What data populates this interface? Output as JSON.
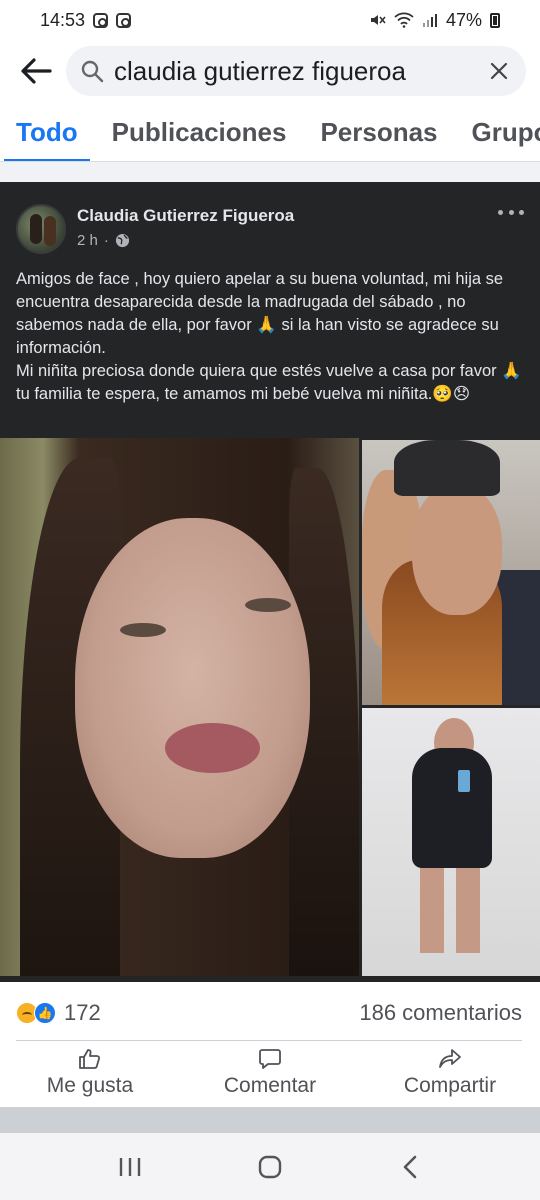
{
  "status_bar": {
    "time": "14:53",
    "battery": "47%"
  },
  "search": {
    "query": "claudia gutierrez figueroa"
  },
  "tabs": [
    {
      "label": "Todo"
    },
    {
      "label": "Publicaciones"
    },
    {
      "label": "Personas"
    },
    {
      "label": "Grupos"
    }
  ],
  "post": {
    "author": "Claudia Gutierrez Figueroa",
    "time": "2 h",
    "separator": "·",
    "body_p1": "Amigos de face , hoy quiero apelar a su buena voluntad, mi hija se encuentra desaparecida desde la madrugada del sábado , no sabemos nada de ella, por favor 🙏 si la han visto se agradece su información.",
    "body_p2": "Mi niñita preciosa donde quiera que estés vuelve a casa por favor 🙏 tu familia te espera, te amamos mi bebé vuelva mi niñita.🥺😞"
  },
  "engagement": {
    "reaction_count": "172",
    "comments": "186 comentarios"
  },
  "actions": {
    "like": "Me gusta",
    "comment": "Comentar",
    "share": "Compartir"
  },
  "icons": {
    "back": "back-arrow-icon",
    "search": "search-icon",
    "clear": "close-icon",
    "globe": "globe-icon",
    "more": "more-dots-icon"
  },
  "colors": {
    "accent": "#1877f2",
    "post_bg": "#242526"
  }
}
